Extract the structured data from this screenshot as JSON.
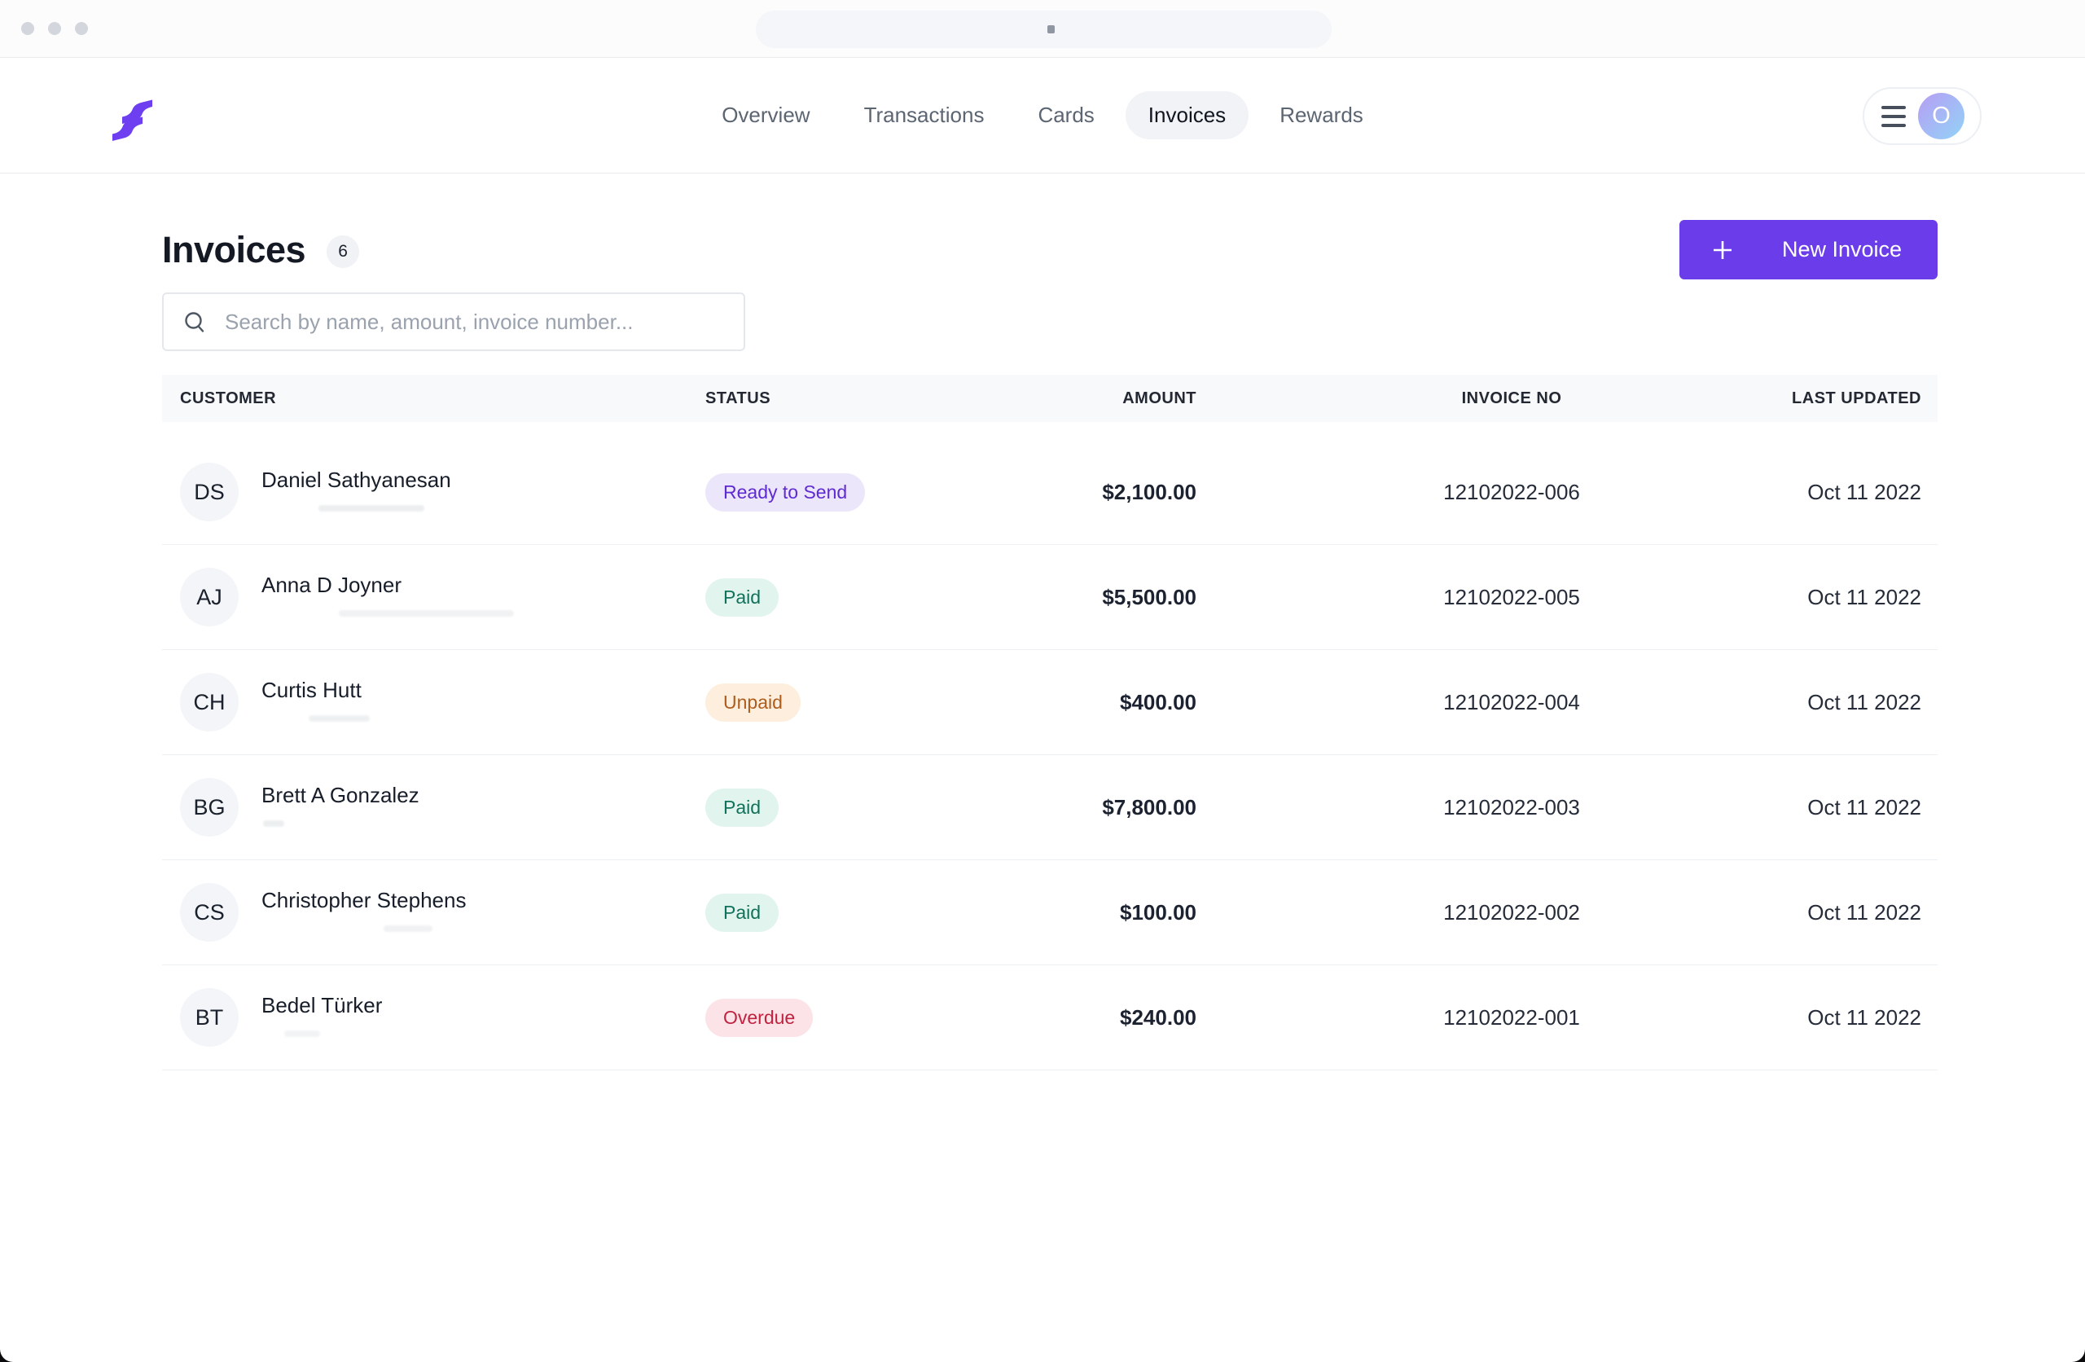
{
  "chrome": {
    "url_value": ""
  },
  "header": {
    "nav": [
      {
        "label": "Overview",
        "state": ""
      },
      {
        "label": "Transactions",
        "state": ""
      },
      {
        "label": "Cards",
        "state": ""
      },
      {
        "label": "Invoices",
        "state": "active"
      },
      {
        "label": "Rewards",
        "state": ""
      }
    ],
    "avatar_initial": "O"
  },
  "page": {
    "title": "Invoices",
    "count_badge": "6",
    "new_invoice_label": "New Invoice",
    "search_placeholder": "Search by name, amount, invoice number..."
  },
  "table": {
    "columns": [
      "CUSTOMER",
      "STATUS",
      "AMOUNT",
      "INVOICE NO",
      "LAST UPDATED"
    ],
    "rows": [
      {
        "initials": "DS",
        "name": "Daniel Sathyanesan",
        "status": "Ready to Send",
        "status_key": "ready",
        "amount": "$2,100.00",
        "invoice_no": "12102022-006",
        "last_updated": "Oct 11 2022"
      },
      {
        "initials": "AJ",
        "name": "Anna D Joyner",
        "status": "Paid",
        "status_key": "paid",
        "amount": "$5,500.00",
        "invoice_no": "12102022-005",
        "last_updated": "Oct 11 2022"
      },
      {
        "initials": "CH",
        "name": "Curtis Hutt",
        "status": "Unpaid",
        "status_key": "unpaid",
        "amount": "$400.00",
        "invoice_no": "12102022-004",
        "last_updated": "Oct 11 2022"
      },
      {
        "initials": "BG",
        "name": "Brett A Gonzalez",
        "status": "Paid",
        "status_key": "paid",
        "amount": "$7,800.00",
        "invoice_no": "12102022-003",
        "last_updated": "Oct 11 2022"
      },
      {
        "initials": "CS",
        "name": "Christopher Stephens",
        "status": "Paid",
        "status_key": "paid",
        "amount": "$100.00",
        "invoice_no": "12102022-002",
        "last_updated": "Oct 11 2022"
      },
      {
        "initials": "BT",
        "name": "Bedel Türker",
        "status": "Overdue",
        "status_key": "overdue",
        "amount": "$240.00",
        "invoice_no": "12102022-001",
        "last_updated": "Oct 11 2022"
      }
    ]
  },
  "colors": {
    "accent": "#6B3CE9",
    "logo": "#6D3FF0",
    "badge_ready_bg": "#ECE6FB",
    "badge_ready_text": "#5E2AD1",
    "badge_paid_bg": "#E1F5EE",
    "badge_paid_text": "#11725B",
    "badge_unpaid_bg": "#FDEEDD",
    "badge_unpaid_text": "#AD5D1E",
    "badge_overdue_bg": "#FCE3E7",
    "badge_overdue_text": "#C02340",
    "avatar_gradient_start": "#B79EF4",
    "avatar_gradient_end": "#92D3F7"
  }
}
